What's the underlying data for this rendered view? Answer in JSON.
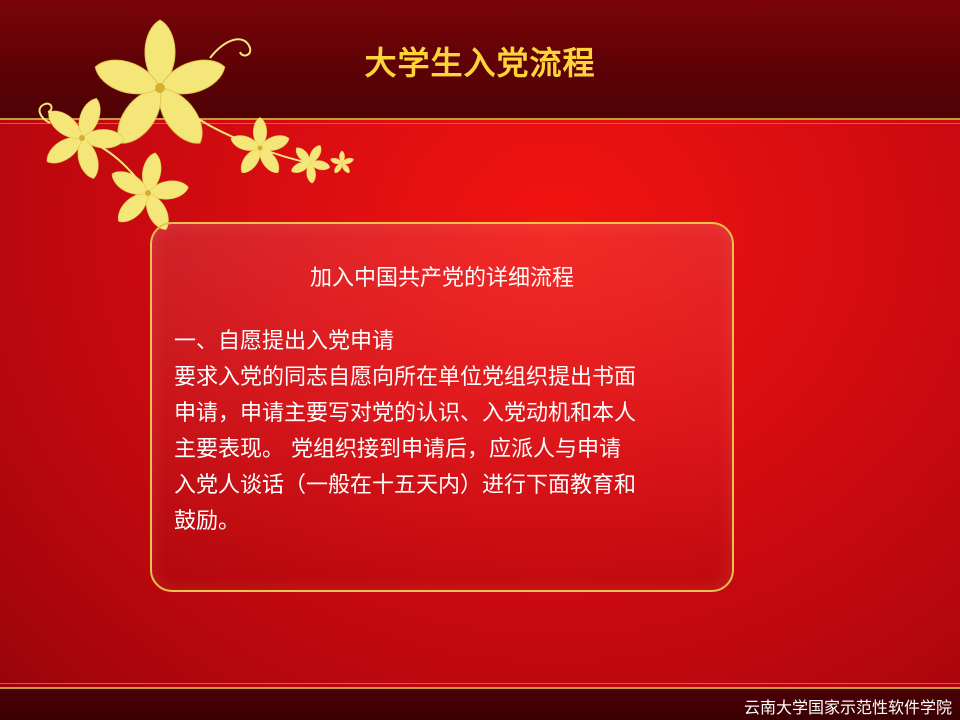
{
  "slide": {
    "title": "大学生入党流程",
    "subtitle": "加入中国共产党的详细流程",
    "heading": "一、自愿提出入党申请",
    "body_lines": [
      "要求入党的同志自愿向所在单位党组织提出书面",
      "申请，申请主要写对党的认识、入党动机和本人",
      "主要表现。 党组织接到申请后，应派人与申请",
      "入党人谈话（一般在十五天内）进行下面教育和",
      "鼓励。"
    ],
    "footer": "云南大学国家示范性软件学院"
  },
  "colors": {
    "background_red": "#d90d12",
    "band_dark": "#5c0206",
    "title_gold": "#ffd43a",
    "accent_gold": "#e8c24a",
    "flower_yellow": "#f5e67a",
    "text_white": "#ffffff"
  },
  "icons": [
    "flower-decoration"
  ]
}
